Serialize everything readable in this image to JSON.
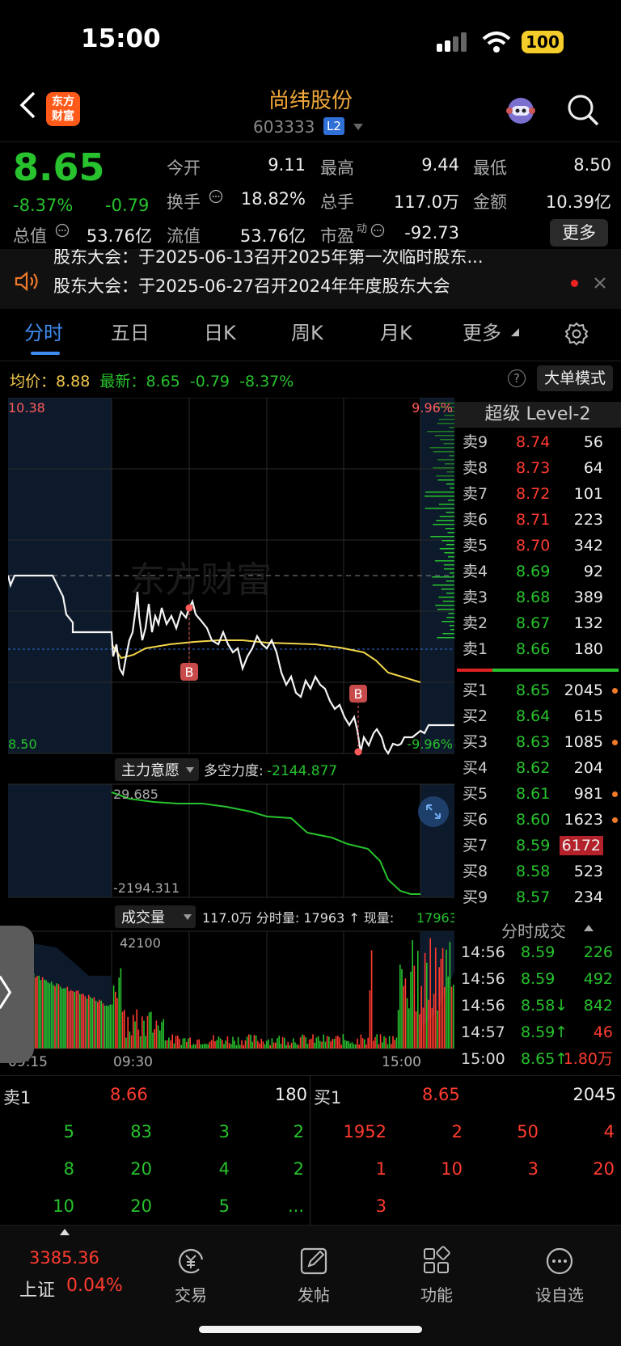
{
  "status_bar": {
    "time": "15:00",
    "battery": "100"
  },
  "header": {
    "name": "尚纬股份",
    "code": "603333",
    "level_badge": "L2",
    "logo_text": "东方\n财富"
  },
  "quote": {
    "price": "8.65",
    "pct": "-8.37%",
    "change": "-0.79",
    "open_label": "今开",
    "open": "9.11",
    "high_label": "最高",
    "high": "9.44",
    "low_label": "最低",
    "low": "8.50",
    "turnover_label": "换手",
    "turnover": "18.82%",
    "volume_label": "总手",
    "volume": "117.0万",
    "amount_label": "金额",
    "amount": "10.39亿",
    "mcap_label": "总值",
    "mcap": "53.76亿",
    "float_label": "流值",
    "float": "53.76亿",
    "pe_label": "市盈",
    "pe_sup": "动",
    "pe": "-92.73",
    "more_label": "更多"
  },
  "notices": [
    "股东大会：于2025-06-13召开2025年第一次临时股东...",
    "股东大会：于2025-06-27召开2024年年度股东大会"
  ],
  "tabs": [
    "分时",
    "五日",
    "日K",
    "周K",
    "月K",
    "更多"
  ],
  "info_row": {
    "avg_label": "均价：",
    "avg": "8.88",
    "latest_label": "最新：",
    "latest": "8.65",
    "latest_chg": "-0.79",
    "latest_pct": "-8.37%",
    "bigorder": "大单模式"
  },
  "chart_labels": {
    "price_high": "10.38",
    "price_low": "8.50",
    "pct_high": "9.96%",
    "pct_low": "-9.96%",
    "watermark": "东方财富",
    "indicator_name": "主力意愿",
    "indicator_text": "多空力度:",
    "indicator_val": "-2144.877",
    "ind_high": "29.685",
    "ind_low": "-2194.311",
    "vol_name": "成交量",
    "vol_text": "117.0万 分时量: 17963 ↑ 现量:",
    "vol_now": "17963",
    "vol_max": "42100",
    "t0": "09:15",
    "t1": "09:30",
    "t2": "15:00",
    "buy_marker": "B"
  },
  "orderbook": {
    "title": "超级 Level-2",
    "asks": [
      {
        "label": "卖9",
        "price": "8.74",
        "vol": "56"
      },
      {
        "label": "卖8",
        "price": "8.73",
        "vol": "64"
      },
      {
        "label": "卖7",
        "price": "8.72",
        "vol": "101"
      },
      {
        "label": "卖6",
        "price": "8.71",
        "vol": "223"
      },
      {
        "label": "卖5",
        "price": "8.70",
        "vol": "342"
      },
      {
        "label": "卖4",
        "price": "8.69",
        "vol": "92"
      },
      {
        "label": "卖3",
        "price": "8.68",
        "vol": "389"
      },
      {
        "label": "卖2",
        "price": "8.67",
        "vol": "132"
      },
      {
        "label": "卖1",
        "price": "8.66",
        "vol": "180"
      }
    ],
    "bids": [
      {
        "label": "买1",
        "price": "8.65",
        "vol": "2045"
      },
      {
        "label": "买2",
        "price": "8.64",
        "vol": "615"
      },
      {
        "label": "买3",
        "price": "8.63",
        "vol": "1085"
      },
      {
        "label": "买4",
        "price": "8.62",
        "vol": "204"
      },
      {
        "label": "买5",
        "price": "8.61",
        "vol": "981"
      },
      {
        "label": "买6",
        "price": "8.60",
        "vol": "1623"
      },
      {
        "label": "买7",
        "price": "8.59",
        "vol": "6172"
      },
      {
        "label": "买8",
        "price": "8.58",
        "vol": "523"
      },
      {
        "label": "买9",
        "price": "8.57",
        "vol": "234"
      }
    ]
  },
  "ticks": {
    "title": "分时成交",
    "rows": [
      {
        "time": "14:56",
        "price": "8.59",
        "vol": "226",
        "color": "green"
      },
      {
        "time": "14:56",
        "price": "8.59",
        "vol": "492",
        "color": "green"
      },
      {
        "time": "14:56",
        "price": "8.58↓",
        "vol": "842",
        "color": "green"
      },
      {
        "time": "14:57",
        "price": "8.59↑",
        "vol": "46",
        "color": "red"
      },
      {
        "time": "15:00",
        "price": "8.65↑",
        "vol": "1.80万",
        "color": "red"
      }
    ]
  },
  "queue": {
    "sell_label": "卖1",
    "sell_price": "8.66",
    "sell_vol": "180",
    "buy_label": "买1",
    "buy_price": "8.65",
    "buy_vol": "2045",
    "sell_cells": [
      "5",
      "83",
      "3",
      "2",
      "8",
      "20",
      "4",
      "2",
      "10",
      "20",
      "5",
      "..."
    ],
    "buy_cells": [
      "1952",
      "2",
      "50",
      "4",
      "1",
      "10",
      "3",
      "20",
      "3"
    ]
  },
  "bottom_nav": {
    "index_value": "3385.36",
    "index_name": "上证",
    "index_pct": "0.04%",
    "items": [
      "交易",
      "发帖",
      "功能",
      "设自选"
    ]
  },
  "colors": {
    "up": "#ff3b30",
    "down": "#27c22d",
    "accent": "#3e8cf0",
    "avg_line": "#f2d54a"
  }
}
